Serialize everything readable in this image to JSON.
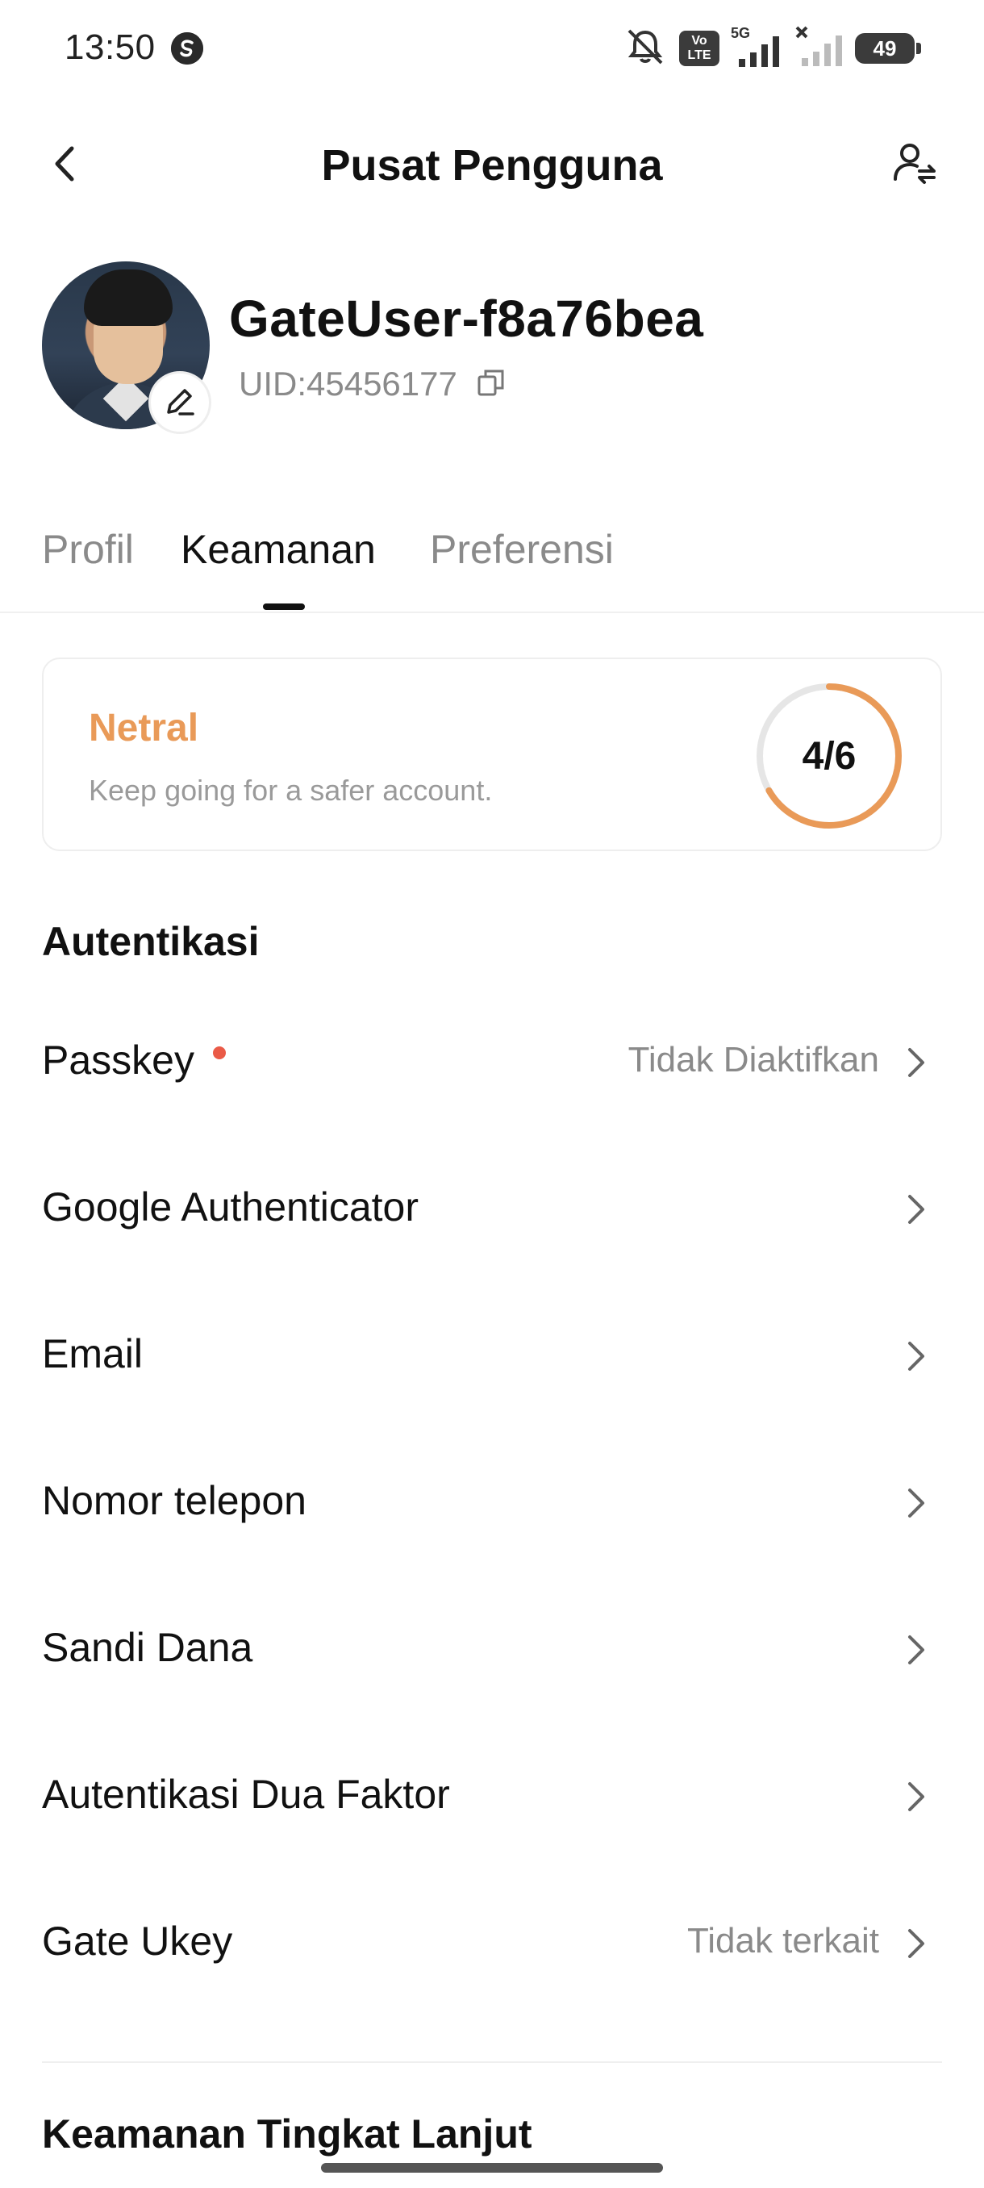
{
  "status_bar": {
    "time": "13:50",
    "network": "5G",
    "volte_top": "Vo",
    "volte_bottom": "LTE",
    "battery": "49",
    "icons": [
      "app-notification-icon",
      "silent-bell-icon",
      "volte-icon",
      "signal-5g-icon",
      "signal-no-service-icon",
      "battery-icon"
    ]
  },
  "header": {
    "title": "Pusat Pengguna",
    "back_icon": "chevron-left-icon",
    "switch_icon": "account-switch-icon"
  },
  "profile": {
    "username": "GateUser-f8a76bea",
    "uid": "UID:45456177",
    "edit_icon": "pencil-icon",
    "copy_icon": "copy-icon"
  },
  "tabs": [
    {
      "label": "Profil",
      "active": false
    },
    {
      "label": "Keamanan",
      "active": true
    },
    {
      "label": "Preferensi",
      "active": false
    }
  ],
  "security_score": {
    "level": "Netral",
    "hint": "Keep going for a safer account.",
    "score_text": "4/6",
    "progress": 0.6667,
    "level_color": "#e99a58",
    "ring_track_color": "#e6e6e6"
  },
  "authentication": {
    "title": "Autentikasi",
    "items": [
      {
        "label": "Passkey",
        "status": "Tidak Diaktifkan",
        "has_dot": true
      },
      {
        "label": "Google Authenticator",
        "status": "",
        "has_dot": false
      },
      {
        "label": "Email",
        "status": "",
        "has_dot": false
      },
      {
        "label": "Nomor telepon",
        "status": "",
        "has_dot": false
      },
      {
        "label": "Sandi Dana",
        "status": "",
        "has_dot": false
      },
      {
        "label": "Autentikasi Dua Faktor",
        "status": "",
        "has_dot": false
      },
      {
        "label": "Gate Ukey",
        "status": "Tidak terkait",
        "has_dot": false
      }
    ]
  },
  "advanced_security": {
    "title": "Keamanan Tingkat Lanjut"
  },
  "colors": {
    "accent_orange": "#e99a58",
    "dot_red": "#ea5a47",
    "text_secondary": "#8a8a8a"
  }
}
